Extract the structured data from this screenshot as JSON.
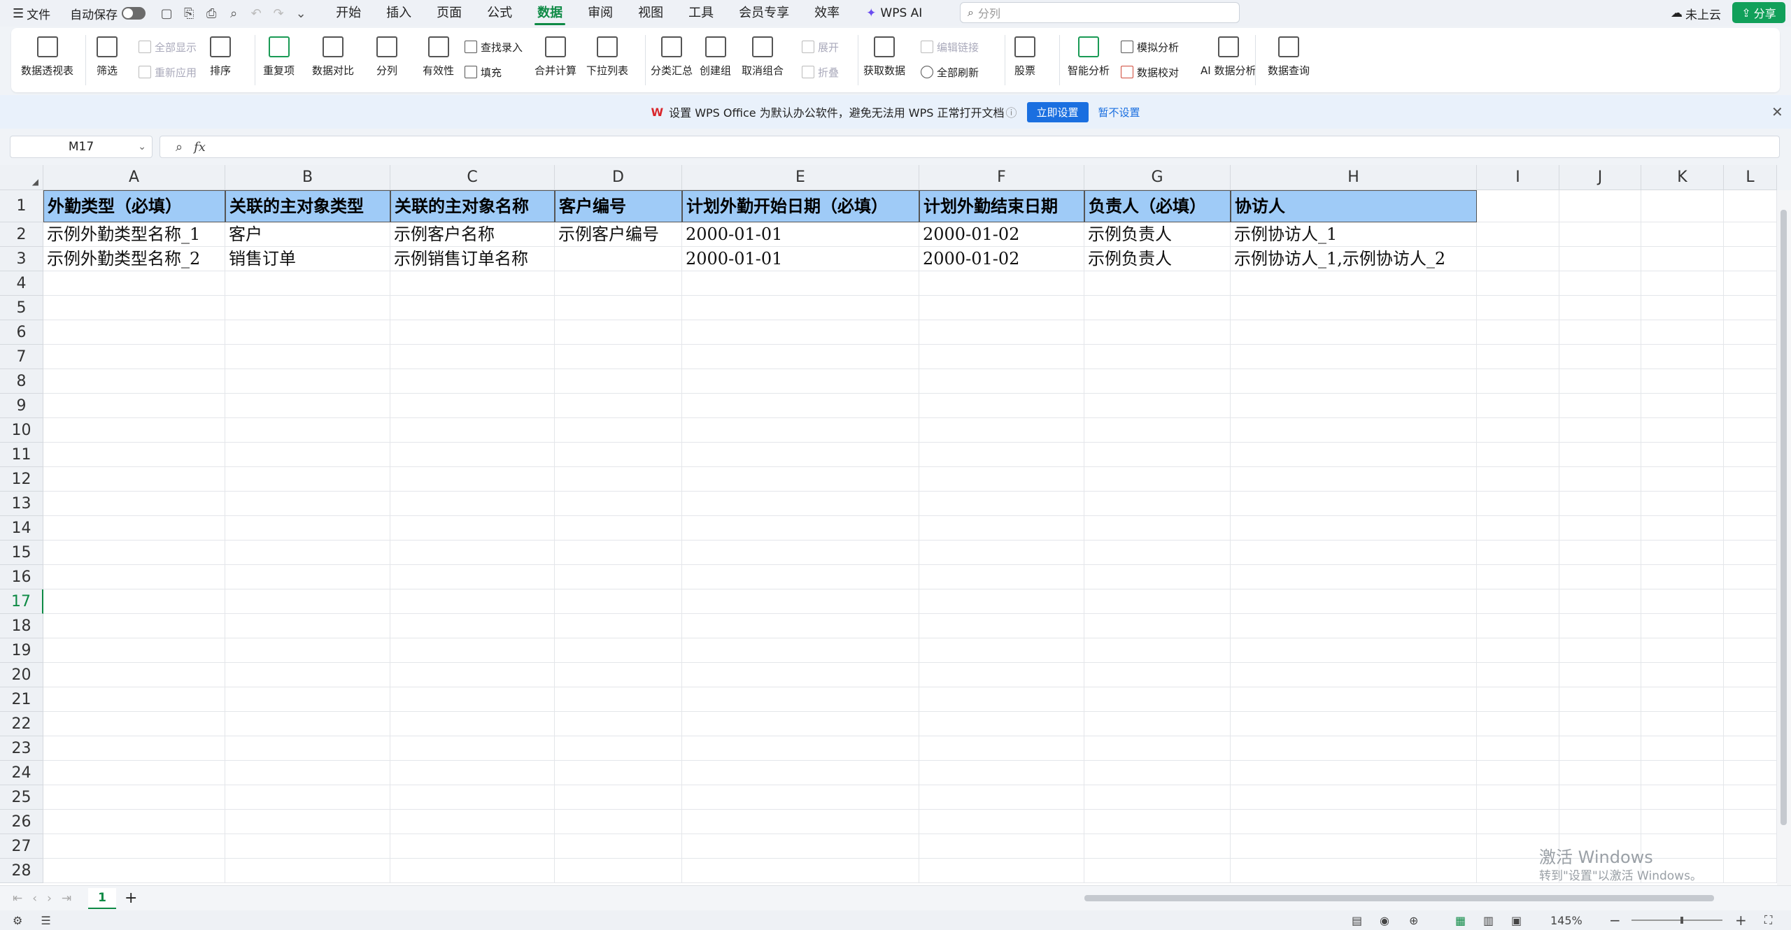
{
  "menubar": {
    "file_label": "文件",
    "autosave_label": "自动保存",
    "tabs": [
      "开始",
      "插入",
      "页面",
      "公式",
      "数据",
      "审阅",
      "视图",
      "工具",
      "会员专享",
      "效率"
    ],
    "active_tab": "数据",
    "wps_ai_label": "WPS AI",
    "search_placeholder": "分列",
    "cloud_label": "未上云",
    "share_label": "分享"
  },
  "ribbon": {
    "pivot": "数据透视表",
    "filter": "筛选",
    "show_all": "全部显示",
    "reapply": "重新应用",
    "sort": "排序",
    "duplicates": "重复项",
    "compare": "数据对比",
    "split": "分列",
    "validity": "有效性",
    "find_entry": "查找录入",
    "fill": "填充",
    "merge_calc": "合并计算",
    "dropdown_list": "下拉列表",
    "subtotal": "分类汇总",
    "create_group": "创建组",
    "ungroup": "取消组合",
    "expand": "展开",
    "collapse": "折叠",
    "get_data": "获取数据",
    "edit_links": "编辑链接",
    "refresh_all": "全部刷新",
    "stocks": "股票",
    "smart_analysis": "智能分析",
    "simulation": "模拟分析",
    "data_check": "数据校对",
    "ai_analysis": "AI 数据分析",
    "data_query": "数据查询"
  },
  "notice": {
    "text": "设置 WPS Office 为默认办公软件，避免无法用 WPS 正常打开文档",
    "set_now": "立即设置",
    "not_now": "暂不设置"
  },
  "formula_bar": {
    "cell_ref": "M17",
    "fx_label": "fx",
    "value": ""
  },
  "columns": [
    "A",
    "B",
    "C",
    "D",
    "E",
    "F",
    "G",
    "H",
    "I",
    "J",
    "K",
    "L"
  ],
  "rows": [
    "1",
    "2",
    "3",
    "4",
    "5",
    "6",
    "7",
    "8",
    "9",
    "10",
    "11",
    "12",
    "13",
    "14",
    "15",
    "16",
    "17",
    "18",
    "19",
    "20",
    "21",
    "22",
    "23",
    "24",
    "25",
    "26",
    "27",
    "28"
  ],
  "selected_row": "17",
  "headers": [
    "外勤类型（必填）",
    "关联的主对象类型",
    "关联的主对象名称",
    "客户编号",
    "计划外勤开始日期（必填）",
    "计划外勤结束日期",
    "负责人（必填）",
    "协访人"
  ],
  "data_rows": [
    [
      "示例外勤类型名称_1",
      "客户",
      "示例客户名称",
      "示例客户编号",
      "2000-01-01",
      "2000-01-02",
      "示例负责人",
      "示例协访人_1"
    ],
    [
      "示例外勤类型名称_2",
      "销售订单",
      "示例销售订单名称",
      "",
      "2000-01-01",
      "2000-01-02",
      "示例负责人",
      "示例协访人_1,示例协访人_2"
    ]
  ],
  "sheet_tabs": [
    "1"
  ],
  "status": {
    "zoom": "145%"
  },
  "watermark": {
    "line1": "激活 Windows",
    "line2": "转到\"设置\"以激活 Windows。"
  },
  "colors": {
    "accent": "#0e8a45",
    "header_fill": "#9fcbf7",
    "blue_button": "#1a6fe0"
  }
}
